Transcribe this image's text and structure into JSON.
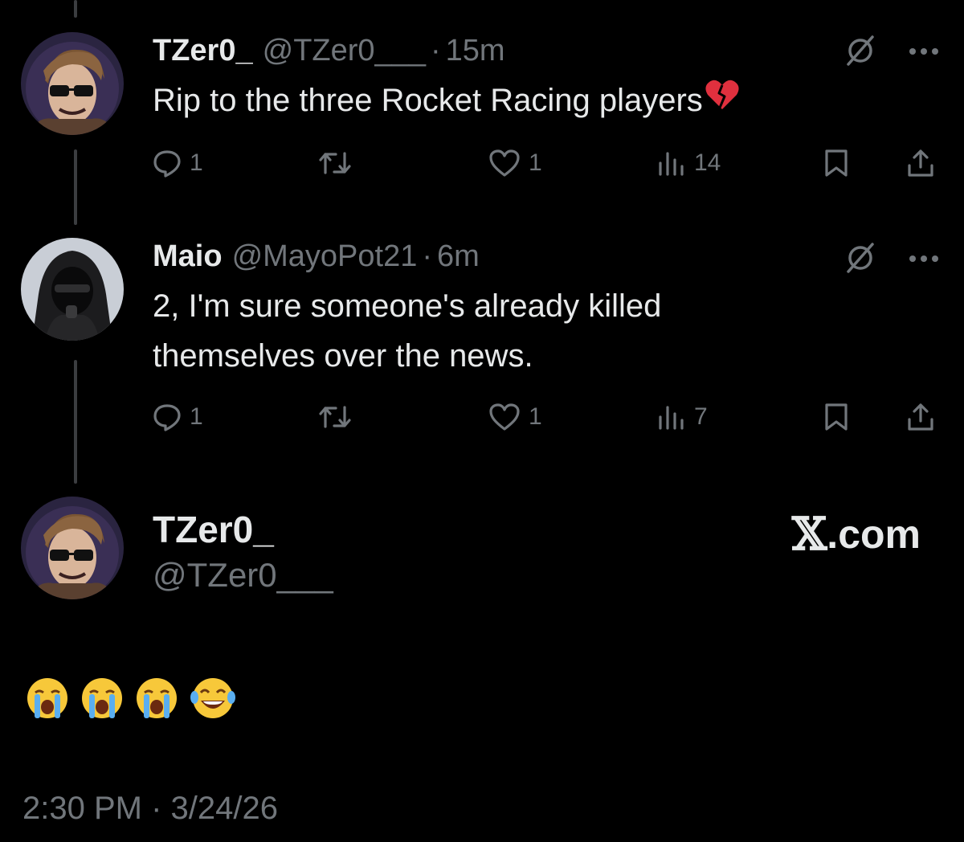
{
  "tweets": [
    {
      "name": "TZer0_",
      "handle": "@TZer0___",
      "time": "15m",
      "text": "Rip to the three Rocket Racing players",
      "replies": "1",
      "retweets": "",
      "likes": "1",
      "views": "14"
    },
    {
      "name": "Maio",
      "handle": "@MayoPot21",
      "time": "6m",
      "text_line1": "2, I'm sure someone's already killed",
      "text_line2": "themselves over the news.",
      "replies": "1",
      "retweets": "",
      "likes": "1",
      "views": "7"
    }
  ],
  "main": {
    "name": "TZer0_",
    "handle": "@TZer0___",
    "brand": ".com",
    "timestamp": "2:30 PM · 3/24/26"
  },
  "separator": "·",
  "icons": {
    "reply": "reply-icon",
    "retweet": "retweet-icon",
    "like": "heart-icon",
    "views": "views-icon",
    "bookmark": "bookmark-icon",
    "share": "share-icon",
    "grok": "grok-icon",
    "more": "more-icon",
    "broken_heart": "broken-heart-emoji",
    "crying": "loudly-crying-emoji",
    "laughing": "tears-of-joy-emoji"
  },
  "colors": {
    "background": "#000000",
    "text": "#e7e9ea",
    "muted": "#71767b",
    "thread_line": "#3b3d40"
  }
}
